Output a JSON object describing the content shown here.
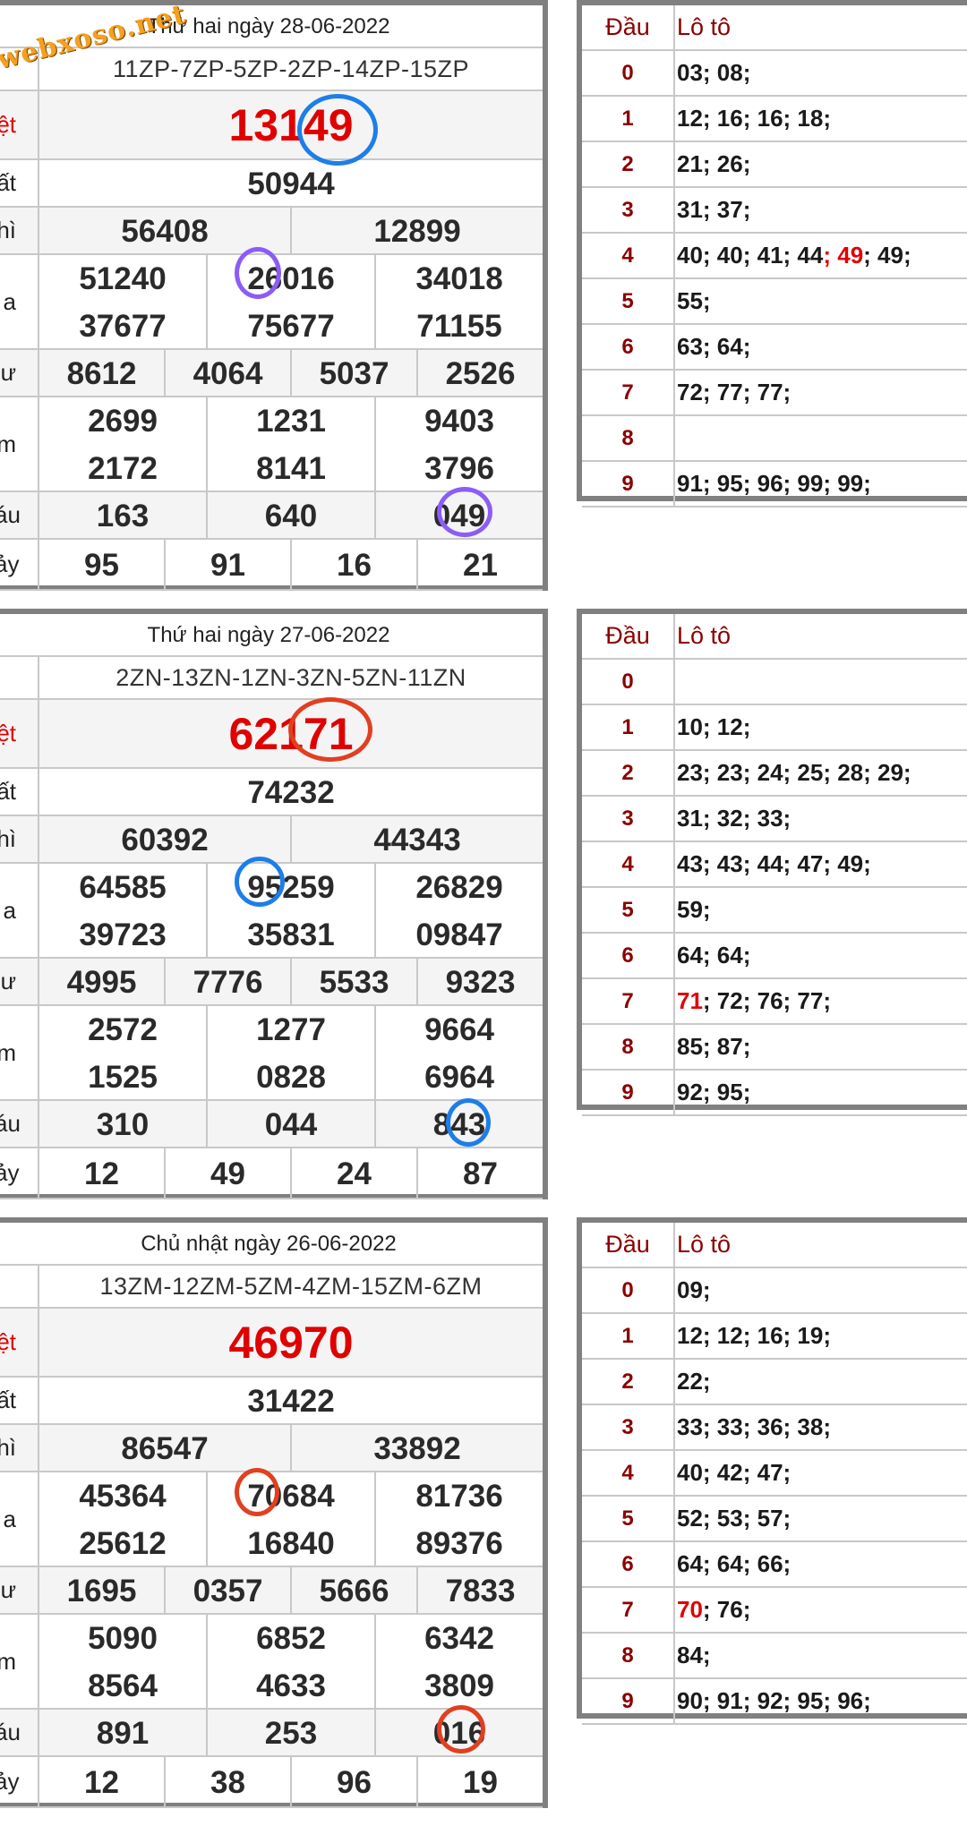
{
  "watermark": "webxoso.net",
  "ring_colors": [
    "#1e7ee8",
    "#8b5cf6",
    "#e04020"
  ],
  "row_labels": [
    "ĐB",
    "Nhất",
    "Nhì",
    "Ba",
    "Tư",
    "Năm",
    "Sáu",
    "Bảy"
  ],
  "row_label_tails": [
    "ệt",
    "ất",
    "hì",
    "a",
    "ư",
    "m",
    "áu",
    "ảy"
  ],
  "loto_header": {
    "dau": "Đầu",
    "loto": "Lô tô"
  },
  "draws": [
    {
      "date": "Thứ hai ngày 28-06-2022",
      "codes": "11ZP-7ZP-5ZP-2ZP-14ZP-15ZP",
      "db": "13149",
      "g1": [
        "50944"
      ],
      "g2": [
        "56408",
        "12899"
      ],
      "g3": [
        "51240",
        "26016",
        "34018",
        "37677",
        "75677",
        "71155"
      ],
      "g4": [
        "8612",
        "4064",
        "5037",
        "2526"
      ],
      "g5": [
        "2699",
        "1231",
        "9403",
        "2172",
        "8141",
        "3796"
      ],
      "g6": [
        "163",
        "640",
        "049"
      ],
      "g7": [
        "95",
        "91",
        "16",
        "21"
      ],
      "loto": [
        "03; 08;",
        "12; 16; 16; 18;",
        "21; 26;",
        "31; 37;",
        "40; 40; 41; 44; 49; 49;",
        "55;",
        "63; 64;",
        "72; 77; 77;",
        "",
        "91; 95; 96; 99; 99;"
      ]
    },
    {
      "date": "Thứ hai ngày 27-06-2022",
      "codes": "2ZN-13ZN-1ZN-3ZN-5ZN-11ZN",
      "db": "62171",
      "g1": [
        "74232"
      ],
      "g2": [
        "60392",
        "44343"
      ],
      "g3": [
        "64585",
        "95259",
        "26829",
        "39723",
        "35831",
        "09847"
      ],
      "g4": [
        "4995",
        "7776",
        "5533",
        "9323"
      ],
      "g5": [
        "2572",
        "1277",
        "9664",
        "1525",
        "0828",
        "6964"
      ],
      "g6": [
        "310",
        "044",
        "843"
      ],
      "g7": [
        "12",
        "49",
        "24",
        "87"
      ],
      "loto": [
        "",
        "10; 12;",
        "23; 23; 24; 25; 28; 29;",
        "31; 32; 33;",
        "43; 43; 44; 47; 49;",
        "59;",
        "64; 64;",
        "71; 72; 76; 77;",
        "85; 87;",
        "92; 95;"
      ]
    },
    {
      "date": "Chủ nhật ngày 26-06-2022",
      "codes": "13ZM-12ZM-5ZM-4ZM-15ZM-6ZM",
      "db": "46970",
      "g1": [
        "31422"
      ],
      "g2": [
        "86547",
        "33892"
      ],
      "g3": [
        "45364",
        "70684",
        "81736",
        "25612",
        "16840",
        "89376"
      ],
      "g4": [
        "1695",
        "0357",
        "5666",
        "7833"
      ],
      "g5": [
        "5090",
        "6852",
        "6342",
        "8564",
        "4633",
        "3809"
      ],
      "g6": [
        "891",
        "253",
        "016"
      ],
      "g7": [
        "12",
        "38",
        "96",
        "19"
      ],
      "loto": [
        "09;",
        "12; 12; 16; 19;",
        "22;",
        "33; 33; 36; 38;",
        "40; 42; 47;",
        "52; 53; 57;",
        "64; 64; 66;",
        "70; 76;",
        "84;",
        "90; 91; 92; 95; 96;"
      ]
    }
  ]
}
